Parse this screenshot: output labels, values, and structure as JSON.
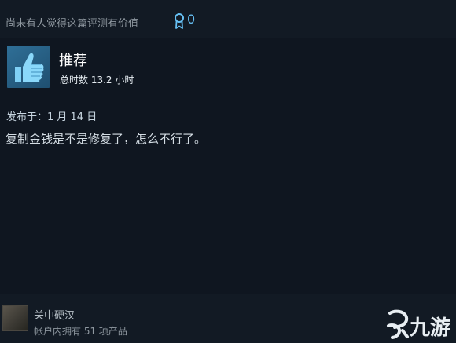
{
  "header": {
    "helpful_text": "尚未有人觉得这篇评测有价值",
    "award_count": "0"
  },
  "review": {
    "verdict": "推荐",
    "hours": "总时数 13.2 小时",
    "posted": "发布于：1 月 14 日",
    "text": "复制金钱是不是修复了，怎么不行了。"
  },
  "author": {
    "name": "关中硬汉",
    "products": "帐户内拥有 51 项产品"
  },
  "watermark": {
    "text": "九游"
  },
  "colors": {
    "background": "#121a24",
    "accent": "#66c0f4",
    "thumb_bg": "#2f6f97"
  },
  "icons": {
    "award": "award-ribbon-icon",
    "thumb": "thumbs-up-icon",
    "watermark": "jiuyou-logo-icon"
  }
}
